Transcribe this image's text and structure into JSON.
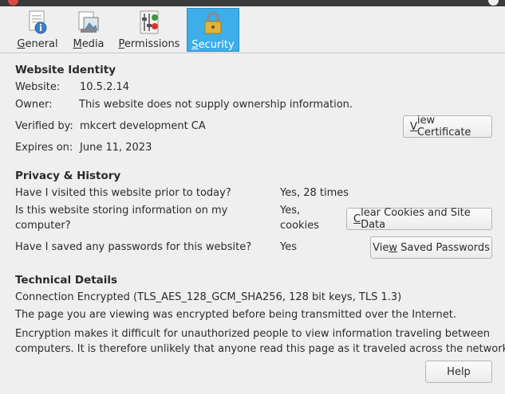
{
  "tabs": [
    {
      "label_acc": "G",
      "label_rest": "eneral",
      "icon": "info-icon"
    },
    {
      "label_acc": "M",
      "label_rest": "edia",
      "icon": "media-icon"
    },
    {
      "label_acc": "P",
      "label_rest": "ermissions",
      "icon": "permissions-icon"
    },
    {
      "label_acc": "S",
      "label_rest": "ecurity",
      "icon": "lock-icon"
    }
  ],
  "identity": {
    "heading": "Website Identity",
    "website_label": "Website:",
    "website_value": "10.5.2.14",
    "owner_label": "Owner:",
    "owner_value": "This website does not supply ownership information.",
    "verified_label": "Verified by:",
    "verified_value": "mkcert development CA",
    "expires_label": "Expires on:",
    "expires_value": "June 11, 2023",
    "view_cert_acc": "V",
    "view_cert_rest": "iew Certificate"
  },
  "privacy": {
    "heading": "Privacy & History",
    "q1": "Have I visited this website prior to today?",
    "a1": "Yes, 28 times",
    "q2_line1": "Is this website storing information on my",
    "q2_line2": "computer?",
    "a2_line1": "Yes,",
    "a2_line2": "cookies",
    "clear_acc": "C",
    "clear_rest": "lear Cookies and Site Data",
    "q3": "Have I saved any passwords for this website?",
    "a3": "Yes",
    "saved_pre": "Vie",
    "saved_acc": "w",
    "saved_rest": " Saved Passwords"
  },
  "technical": {
    "heading": "Technical Details",
    "line1": "Connection Encrypted (TLS_AES_128_GCM_SHA256, 128 bit keys, TLS 1.3)",
    "line2": "The page you are viewing was encrypted before being transmitted over the Internet.",
    "line3": "Encryption makes it difficult for unauthorized people to view information traveling between",
    "line4": "computers. It is therefore unlikely that anyone read this page as it traveled across the network."
  },
  "help_label": "Help",
  "colors": {
    "selected_tab": "#3daee9",
    "background": "#efefef"
  }
}
